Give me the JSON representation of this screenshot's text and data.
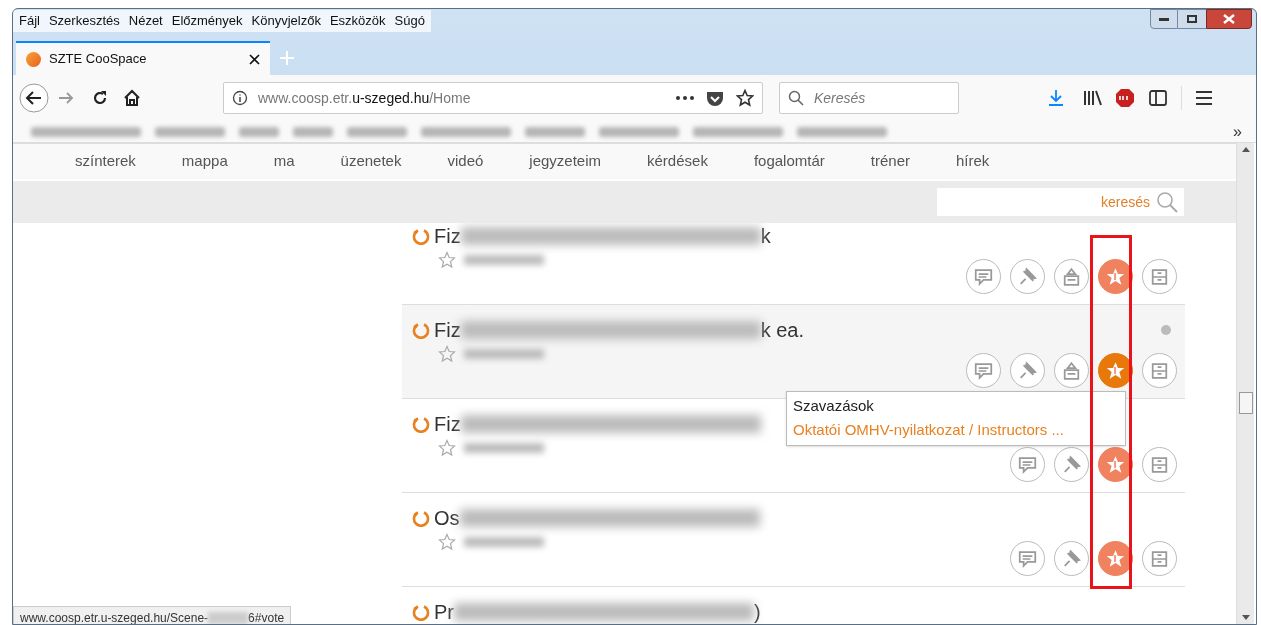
{
  "menu_bar": [
    "Fájl",
    "Szerkesztés",
    "Nézet",
    "Előzmények",
    "Könyvjelzők",
    "Eszközök",
    "Súgó"
  ],
  "tab": {
    "title": "SZTE CooSpace"
  },
  "address_bar": {
    "url_start": "www.coosp.etr.",
    "url_domain": "u-szeged.hu",
    "url_path": "/Home"
  },
  "search_bar": {
    "placeholder": "Keresés"
  },
  "bookmarks_overflow": "»",
  "site_nav": [
    "színterek",
    "mappa",
    "ma",
    "üzenetek",
    "videó",
    "jegyzeteim",
    "kérdések",
    "fogalomtár",
    "tréner",
    "hírek"
  ],
  "site_search": {
    "placeholder": "keresés"
  },
  "rows": [
    {
      "title_start": "Fiz",
      "title_end": "k",
      "highlighted": false,
      "unread": false,
      "actions": [
        {
          "kind": "messages",
          "active": false
        },
        {
          "kind": "pin",
          "active": false
        },
        {
          "kind": "archive",
          "active": false
        },
        {
          "kind": "vote",
          "active": true,
          "hovered": false
        },
        {
          "kind": "cabinet",
          "active": false
        }
      ]
    },
    {
      "title_start": "Fiz",
      "title_end": "k ea.",
      "highlighted": true,
      "unread": true,
      "actions": [
        {
          "kind": "messages",
          "active": false
        },
        {
          "kind": "pin",
          "active": false
        },
        {
          "kind": "archive",
          "active": false
        },
        {
          "kind": "vote",
          "active": true,
          "hovered": true
        },
        {
          "kind": "cabinet",
          "active": false
        }
      ]
    },
    {
      "title_start": "Fiz",
      "title_end": "",
      "highlighted": false,
      "unread": false,
      "actions": [
        {
          "kind": "messages",
          "active": false
        },
        {
          "kind": "pin",
          "active": false
        },
        {
          "kind": "vote",
          "active": true,
          "hovered": false
        },
        {
          "kind": "cabinet",
          "active": false
        }
      ]
    },
    {
      "title_start": "Os",
      "title_end": "",
      "highlighted": false,
      "unread": false,
      "actions": [
        {
          "kind": "messages",
          "active": false
        },
        {
          "kind": "pin",
          "active": false
        },
        {
          "kind": "vote",
          "active": true,
          "hovered": false
        },
        {
          "kind": "cabinet",
          "active": false
        }
      ]
    },
    {
      "title_start": "Pr",
      "title_end": ")",
      "highlighted": false,
      "unread": false,
      "actions": []
    }
  ],
  "tooltip": {
    "title": "Szavazások",
    "link": "Oktatói OMHV-nyilatkozat / Instructors ..."
  },
  "status_bar": {
    "url_start": "www.coosp.etr.u-szeged.hu/Scene-",
    "url_end": "6#vote"
  }
}
